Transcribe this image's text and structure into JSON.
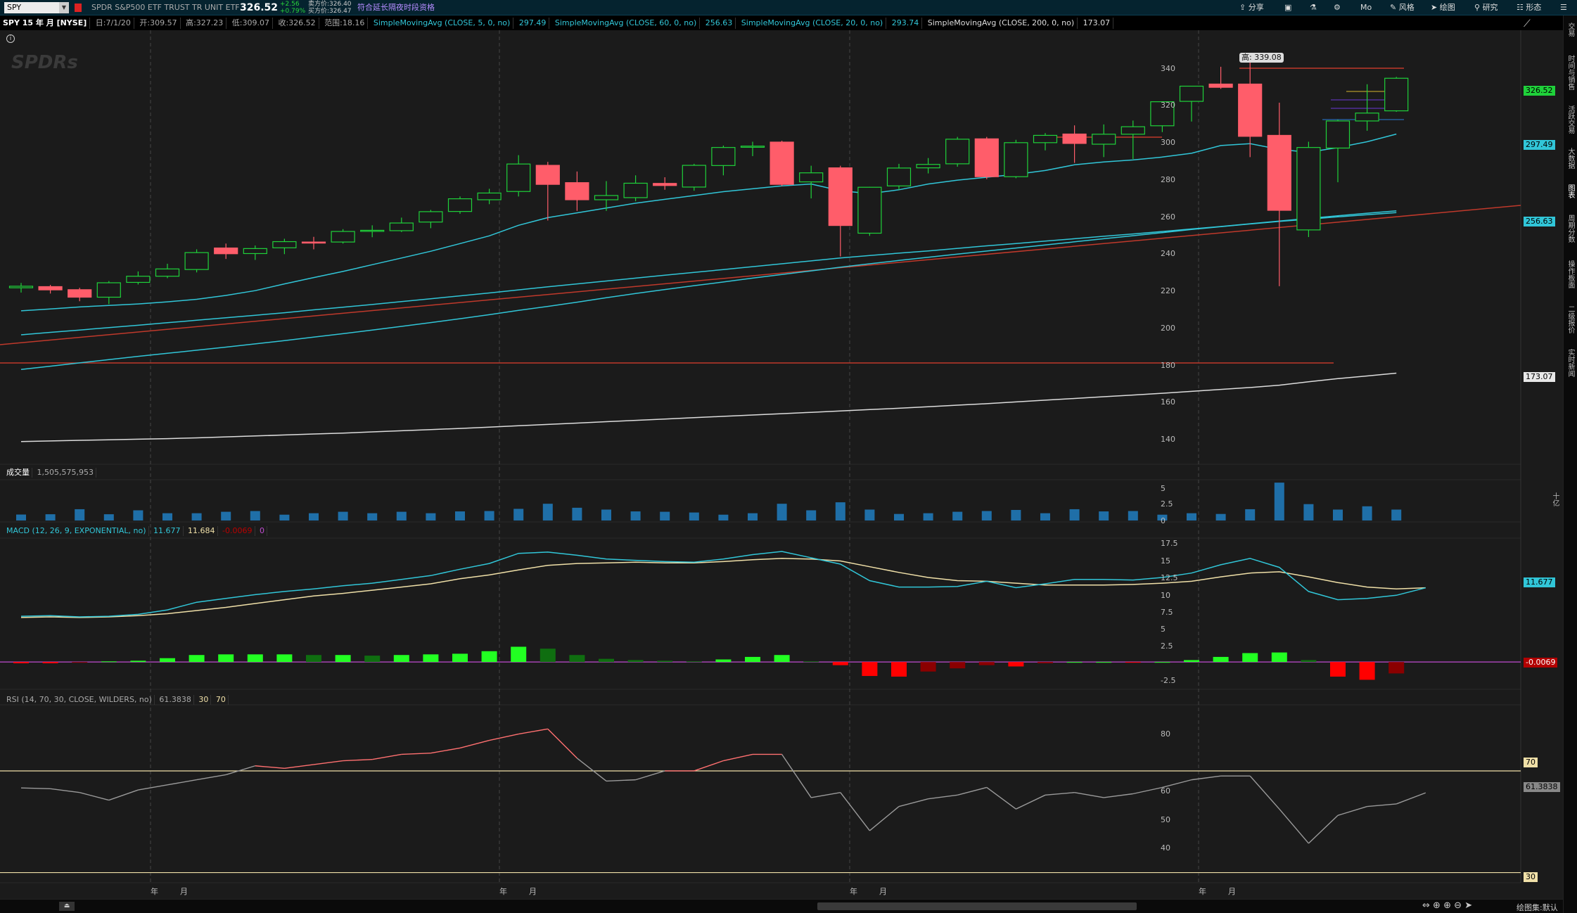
{
  "toolbar": {
    "symbol": "SPY",
    "description": "SPDR S&P500 ETF TRUST TR UNIT ETF",
    "last": "326.52",
    "change": "+2.56",
    "change_pct": "+0.79%",
    "bid": "卖方价:326.40",
    "ask": "买方价:326.47",
    "extended_notice": "符合延长隔夜时段资格",
    "tools": [
      "分享",
      "Mo",
      "风格",
      "绘图",
      "研究",
      "形态"
    ]
  },
  "info": {
    "title": "SPY 15 年 月 [NYSE]",
    "date": "日:7/1/20",
    "open": "开:309.57",
    "high": "高:327.23",
    "low": "低:309.07",
    "close": "收:326.52",
    "range": "范围:18.16",
    "studies": [
      {
        "label": "SimpleMovingAvg (CLOSE, 5, 0, no)",
        "value": "297.49",
        "color": "#31c6d8"
      },
      {
        "label": "SimpleMovingAvg (CLOSE, 60, 0, no)",
        "value": "256.63",
        "color": "#31c6d8"
      },
      {
        "label": "SimpleMovingAvg (CLOSE, 20, 0, no)",
        "value": "293.74",
        "color": "#31c6d8"
      },
      {
        "label": "SimpleMovingAvg (CLOSE, 200, 0, no)",
        "value": "173.07",
        "color": "#dddddd"
      }
    ],
    "watermark": "SPDRs"
  },
  "price_axis": {
    "ticks": [
      "340",
      "320",
      "300",
      "280",
      "260",
      "240",
      "220",
      "200",
      "180",
      "160",
      "140"
    ]
  },
  "price_tags": [
    {
      "text": "326.52",
      "color": "#1fd13a"
    },
    {
      "text": "297.49",
      "color": "#31c6d8"
    },
    {
      "text": "256.63",
      "color": "#31c6d8"
    },
    {
      "text": "173.07",
      "color": "#e8e8e8"
    }
  ],
  "high_tag": "高: 339.08",
  "volume": {
    "title": "成交量",
    "value": "1,505,575,953",
    "ticks": [
      "5",
      "2.5",
      "0"
    ],
    "unit": "十亿"
  },
  "macd": {
    "title": "MACD (12, 26, 9, EXPONENTIAL, no)",
    "value": "11.677",
    "avg": "11.684",
    "diff": "-0.0069",
    "zero": "0",
    "ticks": [
      "17.5",
      "15",
      "12.5",
      "10",
      "7.5",
      "5",
      "2.5",
      "-2.5"
    ],
    "tag_value": "11.677",
    "tag_diff": "-0.0069"
  },
  "rsi": {
    "title": "RSI (14, 70, 30, CLOSE, WILDERS, no)",
    "value": "61.3838",
    "ob": "30",
    "os": "70",
    "ticks": [
      "80",
      "60",
      "50",
      "40"
    ],
    "tag_ob": "70",
    "tag_value": "61.3838",
    "tag_os": "30"
  },
  "x_axis": {
    "labels": [
      "年",
      "月",
      "年",
      "月",
      "年",
      "月",
      "年",
      "月"
    ]
  },
  "right_tabs": [
    "交易",
    "时间与销售",
    "活跃交易",
    "大数据",
    "图表",
    "周期分数",
    "操作板面",
    "二级报价",
    "实时新闻"
  ],
  "bottom": {
    "status": "绘图集:默认"
  },
  "chart_data": {
    "type": "candlestick",
    "title": "SPY 15 年 月 [NYSE]",
    "ylim": [
      130,
      350
    ],
    "candles": [
      {
        "o": 217.5,
        "h": 220,
        "l": 215,
        "c": 218.3
      },
      {
        "o": 218.1,
        "h": 219,
        "l": 214.5,
        "c": 216.4
      },
      {
        "o": 216.5,
        "h": 217.5,
        "l": 210.5,
        "c": 212.6
      },
      {
        "o": 212.6,
        "h": 221,
        "l": 209,
        "c": 220.1
      },
      {
        "o": 220.3,
        "h": 226,
        "l": 219.2,
        "c": 223.5
      },
      {
        "o": 223.5,
        "h": 230,
        "l": 222.5,
        "c": 227.3
      },
      {
        "o": 227,
        "h": 237.5,
        "l": 225.5,
        "c": 235.8
      },
      {
        "o": 238.2,
        "h": 240.5,
        "l": 232.5,
        "c": 235.2
      },
      {
        "o": 235.3,
        "h": 239.5,
        "l": 232,
        "c": 237.9
      },
      {
        "o": 238.3,
        "h": 243,
        "l": 235,
        "c": 241.5
      },
      {
        "o": 241.3,
        "h": 244,
        "l": 237.5,
        "c": 241
      },
      {
        "o": 241.3,
        "h": 248,
        "l": 240.5,
        "c": 246.8
      },
      {
        "o": 247,
        "h": 250,
        "l": 243.8,
        "c": 247.4
      },
      {
        "o": 247.2,
        "h": 254,
        "l": 246.5,
        "c": 251.2
      },
      {
        "o": 251.7,
        "h": 258,
        "l": 248.5,
        "c": 257.1
      },
      {
        "o": 257.2,
        "h": 265,
        "l": 256,
        "c": 263.8
      },
      {
        "o": 263.3,
        "h": 269,
        "l": 261,
        "c": 266.8
      },
      {
        "o": 267.6,
        "h": 286.5,
        "l": 265,
        "c": 281.9
      },
      {
        "o": 281.2,
        "h": 283,
        "l": 252.5,
        "c": 271.3
      },
      {
        "o": 272.2,
        "h": 278,
        "l": 257.5,
        "c": 263.3
      },
      {
        "o": 263.3,
        "h": 273,
        "l": 257.5,
        "c": 265.5
      },
      {
        "o": 264.4,
        "h": 276,
        "l": 262.5,
        "c": 271.9
      },
      {
        "o": 271.8,
        "h": 275,
        "l": 268.5,
        "c": 270.7
      },
      {
        "o": 269.9,
        "h": 282,
        "l": 268,
        "c": 281.2
      },
      {
        "o": 281.1,
        "h": 291.5,
        "l": 276,
        "c": 290.5
      },
      {
        "o": 290.6,
        "h": 293.5,
        "l": 286,
        "c": 291.2
      },
      {
        "o": 293.3,
        "h": 294,
        "l": 270.5,
        "c": 271.3
      },
      {
        "o": 272.6,
        "h": 281,
        "l": 264,
        "c": 277.3
      },
      {
        "o": 279.9,
        "h": 281,
        "l": 233.8,
        "c": 249.9
      },
      {
        "o": 245.9,
        "h": 270,
        "l": 244.5,
        "c": 269.8
      },
      {
        "o": 270.5,
        "h": 282,
        "l": 268.5,
        "c": 279.8
      },
      {
        "o": 279.9,
        "h": 285,
        "l": 277,
        "c": 281.7
      },
      {
        "o": 282,
        "h": 296,
        "l": 280.5,
        "c": 294.8
      },
      {
        "o": 295,
        "h": 296,
        "l": 274,
        "c": 275.3
      },
      {
        "o": 275.3,
        "h": 294.5,
        "l": 274.5,
        "c": 293
      },
      {
        "o": 293,
        "h": 298,
        "l": 289,
        "c": 296.8
      },
      {
        "o": 297.5,
        "h": 302,
        "l": 282.5,
        "c": 292.6
      },
      {
        "o": 292.2,
        "h": 302.5,
        "l": 285.5,
        "c": 297.4
      },
      {
        "o": 297.4,
        "h": 304.5,
        "l": 284.5,
        "c": 301.3
      },
      {
        "o": 301.8,
        "h": 310.5,
        "l": 298.5,
        "c": 314.3
      },
      {
        "o": 314.5,
        "h": 322.5,
        "l": 304,
        "c": 322.4
      },
      {
        "o": 323.5,
        "h": 332.5,
        "l": 321,
        "c": 321.8
      },
      {
        "o": 323.5,
        "h": 339.08,
        "l": 285.5,
        "c": 296.3
      },
      {
        "o": 296.8,
        "h": 313.8,
        "l": 218.3,
        "c": 257.8
      },
      {
        "o": 247.6,
        "h": 293.5,
        "l": 243.9,
        "c": 290.5
      },
      {
        "o": 290.2,
        "h": 305,
        "l": 272.4,
        "c": 304.3
      },
      {
        "o": 304.3,
        "h": 323.4,
        "l": 299.2,
        "c": 308.4
      },
      {
        "o": 309.57,
        "h": 327.23,
        "l": 309.07,
        "c": 326.52
      }
    ],
    "ma5": [
      205.5,
      206.5,
      207.5,
      208.3,
      209.1,
      210.2,
      211.5,
      213.5,
      216,
      219.5,
      222.8,
      226,
      229.5,
      233,
      236.5,
      240.5,
      244.5,
      250,
      254,
      256.5,
      259,
      261.5,
      263.5,
      265.5,
      267.5,
      269,
      270.5,
      271.5,
      268,
      266.5,
      268.5,
      271.5,
      273.5,
      275,
      276.5,
      278.5,
      281.5,
      283,
      284,
      285.5,
      287.5,
      291.5,
      292.5,
      289.5,
      288,
      290.5,
      293.5,
      297.49
    ],
    "ma20": [
      193,
      194.3,
      195.5,
      196.8,
      198,
      199.3,
      200.6,
      201.9,
      203.2,
      204.5,
      206,
      207.4,
      208.8,
      210.3,
      211.8,
      213.3,
      214.8,
      216.4,
      218,
      219.5,
      221,
      222.5,
      224,
      225.5,
      227,
      228.5,
      230,
      231.5,
      233,
      234.3,
      235.5,
      236.7,
      238,
      239.3,
      240.5,
      241.8,
      243,
      244.3,
      245.5,
      246.8,
      248.1,
      249.4,
      250.8,
      252.2,
      253.6,
      255,
      256.3,
      257.5
    ],
    "ma60": [
      175,
      176.7,
      178.4,
      180.1,
      181.8,
      183.4,
      185,
      186.6,
      188.3,
      190,
      191.8,
      193.6,
      195.5,
      197.4,
      199.4,
      201.4,
      203.5,
      205.7,
      207.8,
      210,
      212.3,
      214.5,
      216.6,
      218.6,
      220.5,
      222.5,
      224.4,
      226.3,
      228.2,
      230,
      231.7,
      233.4,
      235,
      236.6,
      238.2,
      239.8,
      241.4,
      243,
      244.6,
      246.2,
      247.8,
      249.3,
      250.7,
      252,
      253.2,
      254.4,
      255.5,
      256.63
    ],
    "ma200": [
      137.5,
      137.8,
      138.1,
      138.4,
      138.7,
      139,
      139.4,
      139.9,
      140.4,
      140.9,
      141.4,
      141.9,
      142.5,
      143.1,
      143.7,
      144.3,
      145,
      145.7,
      146.4,
      147.1,
      147.8,
      148.5,
      149.2,
      149.9,
      150.6,
      151.3,
      152,
      152.7,
      153.4,
      154.1,
      154.8,
      155.6,
      156.4,
      157.2,
      158.1,
      159,
      159.9,
      160.8,
      161.7,
      162.6,
      163.6,
      164.6,
      165.6,
      166.8,
      168.6,
      170.2,
      171.6,
      173.07
    ],
    "volumes": [
      0.82,
      0.86,
      1.55,
      0.86,
      1.4,
      1.0,
      1.0,
      1.2,
      1.3,
      0.8,
      1.0,
      1.2,
      1.0,
      1.2,
      1.0,
      1.25,
      1.3,
      1.6,
      2.3,
      1.75,
      1.5,
      1.25,
      1.2,
      1.1,
      0.8,
      1.0,
      2.3,
      1.4,
      2.5,
      1.5,
      0.9,
      1.0,
      1.2,
      1.3,
      1.45,
      1.0,
      1.55,
      1.25,
      1.3,
      0.8,
      1.0,
      0.9,
      1.55,
      5.2,
      2.25,
      1.5,
      1.95,
      1.5
    ],
    "macd": [
      7.2,
      7.3,
      7.1,
      7.2,
      7.5,
      8.2,
      9.4,
      10.0,
      10.6,
      11.1,
      11.5,
      12.0,
      12.4,
      13.0,
      13.6,
      14.6,
      15.5,
      17.1,
      17.3,
      16.8,
      16.2,
      16.0,
      15.8,
      15.7,
      16.2,
      16.9,
      17.4,
      16.4,
      15.4,
      12.8,
      11.8,
      11.8,
      11.9,
      12.7,
      11.7,
      12.3,
      13.0,
      13.0,
      12.9,
      13.3,
      14.0,
      15.3,
      16.3,
      14.9,
      11.1,
      9.8,
      10.0,
      10.5,
      11.677
    ],
    "macd_avg": [
      7.0,
      7.1,
      7.0,
      7.1,
      7.3,
      7.6,
      8.1,
      8.6,
      9.2,
      9.8,
      10.4,
      10.8,
      11.3,
      11.8,
      12.3,
      13.1,
      13.7,
      14.5,
      15.2,
      15.5,
      15.6,
      15.7,
      15.6,
      15.6,
      15.8,
      16.1,
      16.3,
      16.2,
      15.9,
      15.0,
      14.1,
      13.3,
      12.8,
      12.7,
      12.4,
      12.1,
      12.1,
      12.1,
      12.2,
      12.4,
      12.7,
      13.4,
      14.0,
      14.2,
      13.4,
      12.5,
      11.8,
      11.5,
      11.684
    ],
    "macd_hist": [
      -0.2,
      -0.2,
      -0.1,
      0.1,
      0.2,
      0.6,
      1.1,
      1.2,
      1.2,
      1.2,
      1.1,
      1.1,
      1.0,
      1.1,
      1.2,
      1.3,
      1.7,
      2.4,
      2.1,
      1.1,
      0.5,
      0.3,
      0.2,
      0.1,
      0.4,
      0.8,
      1.1,
      0.1,
      -0.5,
      -2.2,
      -2.3,
      -1.5,
      -1.0,
      -0.5,
      -0.7,
      -0.2,
      0.0,
      0.0,
      -0.1,
      0.0,
      0.3,
      0.8,
      1.4,
      1.5,
      0.3,
      -2.3,
      -2.8,
      -1.8,
      -1.3
    ],
    "rsi": [
      63.3,
      63.0,
      61.5,
      58.5,
      62.5,
      64.5,
      66.5,
      68.5,
      72.0,
      71.0,
      72.5,
      74.0,
      74.5,
      76.5,
      77.0,
      79.0,
      82.0,
      84.5,
      86.5,
      75.0,
      66.0,
      66.5,
      70.0,
      70.0,
      74.0,
      76.5,
      76.5,
      59.5,
      61.5,
      46.5,
      56.0,
      59.0,
      60.5,
      63.5,
      55.0,
      60.5,
      61.5,
      59.5,
      61.0,
      63.5,
      66.5,
      68.0,
      68.0,
      55.0,
      41.5,
      52.5,
      56.0,
      57.0,
      61.3838
    ],
    "rsi_ylim": [
      26,
      96
    ]
  }
}
